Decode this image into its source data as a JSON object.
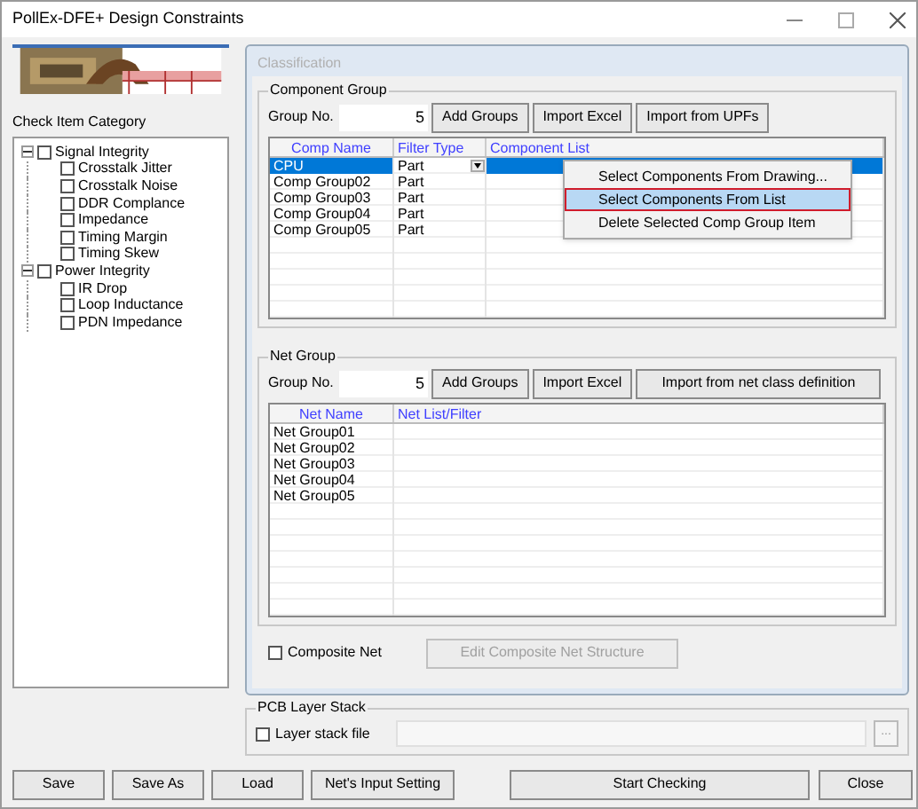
{
  "window": {
    "title": "PollEx-DFE+ Design Constraints"
  },
  "sidebar": {
    "label": "Check Item Category",
    "tree": [
      {
        "label": "Signal Integrity",
        "checked": false,
        "expanded": true,
        "children": [
          {
            "label": "Crosstalk Jitter",
            "checked": false
          },
          {
            "label": "Crosstalk Noise",
            "checked": false
          },
          {
            "label": "DDR Complance",
            "checked": false
          },
          {
            "label": "Impedance",
            "checked": false
          },
          {
            "label": "Timing Margin",
            "checked": false
          },
          {
            "label": "Timing Skew",
            "checked": false
          }
        ]
      },
      {
        "label": "Power Integrity",
        "checked": false,
        "expanded": true,
        "children": [
          {
            "label": "IR Drop",
            "checked": false
          },
          {
            "label": "Loop Inductance",
            "checked": false
          },
          {
            "label": "PDN Impedance",
            "checked": false
          }
        ]
      }
    ]
  },
  "classification": {
    "title": "Classification",
    "component_group": {
      "title": "Component Group",
      "group_no_label": "Group No.",
      "group_no": "5",
      "buttons": [
        "Add Groups",
        "Import Excel",
        "Import from UPFs"
      ],
      "columns": [
        "Comp Name",
        "Filter Type",
        "Component List"
      ],
      "rows": [
        {
          "name": "CPU",
          "filter": "Part",
          "selected": true
        },
        {
          "name": "Comp Group02",
          "filter": "Part",
          "selected": false
        },
        {
          "name": "Comp Group03",
          "filter": "Part",
          "selected": false
        },
        {
          "name": "Comp Group04",
          "filter": "Part",
          "selected": false
        },
        {
          "name": "Comp Group05",
          "filter": "Part",
          "selected": false
        }
      ]
    },
    "context_menu": {
      "items": [
        {
          "label": "Select Components From Drawing...",
          "selected": false
        },
        {
          "label": "Select Components From List",
          "selected": true
        },
        {
          "label": "Delete Selected Comp Group Item",
          "selected": false
        }
      ]
    },
    "net_group": {
      "title": "Net Group",
      "group_no_label": "Group No.",
      "group_no": "5",
      "buttons": [
        "Add Groups",
        "Import Excel",
        "Import from net class definition"
      ],
      "columns": [
        "Net Name",
        "Net List/Filter"
      ],
      "rows": [
        {
          "name": "Net Group01"
        },
        {
          "name": "Net Group02"
        },
        {
          "name": "Net Group03"
        },
        {
          "name": "Net Group04"
        },
        {
          "name": "Net Group05"
        }
      ]
    },
    "composite_net": {
      "label": "Composite Net",
      "checked": false
    },
    "edit_button": {
      "label": "Edit Composite Net Structure",
      "disabled": true
    }
  },
  "pcb_layer_stack": {
    "title": "PCB Layer Stack",
    "checkbox": {
      "label": "Layer stack file",
      "checked": false
    },
    "browse_button": "..."
  },
  "buttons": [
    "Save",
    "Save As",
    "Load",
    "Net's Input Setting",
    "Start Checking",
    "Close"
  ]
}
